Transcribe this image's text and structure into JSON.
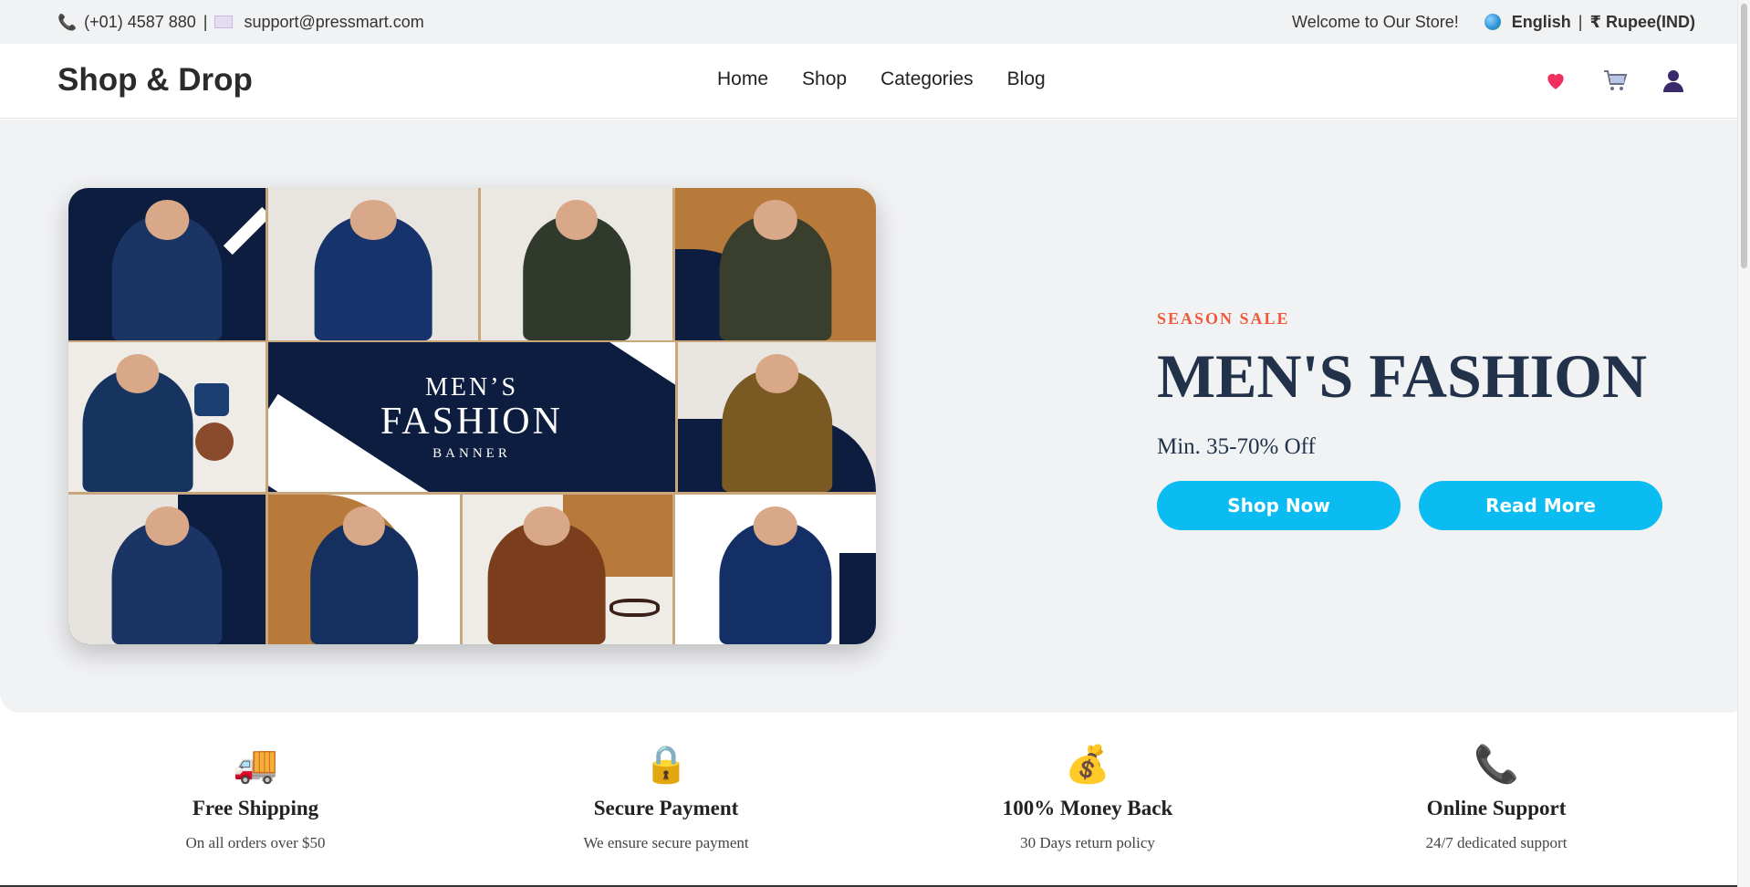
{
  "topbar": {
    "phone": "(+01) 4587 880",
    "separator": "|",
    "email": "support@pressmart.com",
    "welcome": "Welcome to Our Store!",
    "language": "English",
    "currency": "₹ Rupee(IND)"
  },
  "header": {
    "logo": "Shop & Drop",
    "nav": [
      "Home",
      "Shop",
      "Categories",
      "Blog"
    ],
    "icons": [
      "heart-icon",
      "cart-icon",
      "user-icon"
    ]
  },
  "hero": {
    "banner": {
      "line1": "MEN’S",
      "line2": "FASHION",
      "line3": "BANNER"
    },
    "eyebrow": "SEASON SALE",
    "title": "MEN'S FASHION",
    "subtitle": "Min. 35-70% Off",
    "primary_button": "Shop Now",
    "secondary_button": "Read More",
    "button_color": "#0bbcf2",
    "eyebrow_color": "#ef5a3c",
    "title_color": "#22324a"
  },
  "features": [
    {
      "icon": "truck-icon",
      "glyph": "🚚",
      "title": "Free Shipping",
      "desc": "On all orders over $50"
    },
    {
      "icon": "lock-icon",
      "glyph": "🔒",
      "title": "Secure Payment",
      "desc": "We ensure secure payment"
    },
    {
      "icon": "money-bag-icon",
      "glyph": "💰",
      "title": "100% Money Back",
      "desc": "30 Days return policy"
    },
    {
      "icon": "phone-icon",
      "glyph": "📞",
      "title": "Online Support",
      "desc": "24/7 dedicated support"
    }
  ]
}
